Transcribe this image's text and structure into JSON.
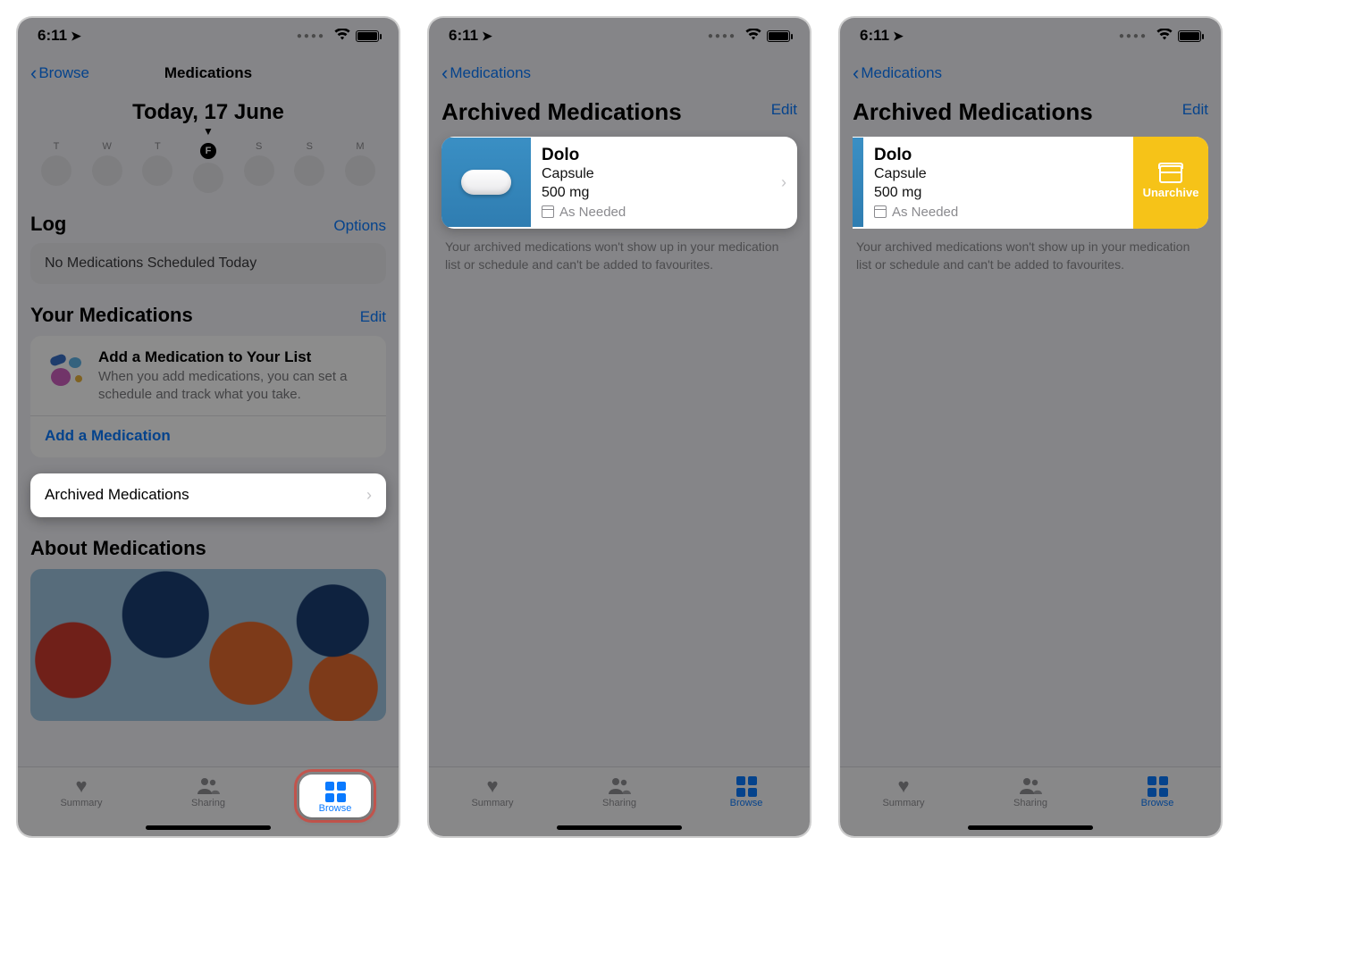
{
  "statusbar": {
    "time": "6:11"
  },
  "screen1": {
    "back_label": "Browse",
    "nav_title": "Medications",
    "today_title": "Today, 17 June",
    "days": [
      "T",
      "W",
      "T",
      "F",
      "S",
      "S",
      "M"
    ],
    "active_day_letter": "F",
    "log": {
      "title": "Log",
      "options": "Options",
      "empty": "No Medications Scheduled Today"
    },
    "your_meds": {
      "title": "Your Medications",
      "edit": "Edit",
      "add_title": "Add a Medication to Your List",
      "add_sub": "When you add medications, you can set a schedule and track what you take.",
      "add_link": "Add a Medication"
    },
    "archived_row": "Archived Medications",
    "about_title": "About Medications"
  },
  "tabs": {
    "summary": "Summary",
    "sharing": "Sharing",
    "browse": "Browse"
  },
  "archived": {
    "back_label": "Medications",
    "title": "Archived Medications",
    "edit": "Edit",
    "item": {
      "name": "Dolo",
      "form": "Capsule",
      "dose": "500 mg",
      "schedule": "As Needed"
    },
    "note": "Your archived medications won't show up in your medication list or schedule and can't be added to favourites.",
    "unarchive": "Unarchive"
  }
}
